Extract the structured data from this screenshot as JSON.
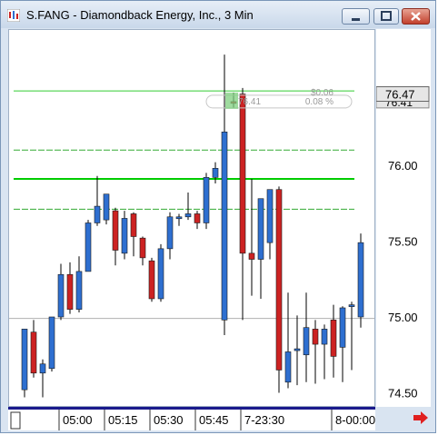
{
  "window": {
    "title": "S.FANG - Diamondback Energy, Inc., 3 Min"
  },
  "chart_data": {
    "type": "candlestick",
    "symbol": "S.FANG",
    "timeframe": "3 Min",
    "ylim": [
      74.4,
      76.85
    ],
    "y_ticks": [
      "76.00",
      "75.50",
      "75.00",
      "74.50"
    ],
    "y_tick_values": [
      76.0,
      75.5,
      75.0,
      74.5
    ],
    "x_ticks": [
      "05:00",
      "05:15",
      "05:30",
      "05:45",
      "7-23:30",
      "8-00:00"
    ],
    "x_tick_index": [
      3,
      8,
      13,
      18,
      23,
      33
    ],
    "price_label": "76.47",
    "price_label_value": 76.47,
    "sub_label": "76.41",
    "sub_label_value": 76.42,
    "order_tag": {
      "price": "76.41",
      "change": "$0.06",
      "percent": "0.08 %"
    },
    "horizontal_lines": [
      {
        "price": 76.49,
        "style": "solid",
        "color": "#33cc33"
      },
      {
        "price": 76.1,
        "style": "dashed",
        "color": "#33aa33"
      },
      {
        "price": 75.91,
        "style": "solid",
        "color": "#00cc00"
      },
      {
        "price": 75.71,
        "style": "dashed",
        "color": "#33aa33"
      },
      {
        "price": 74.99,
        "style": "solid",
        "color": "#b0b0b0"
      }
    ],
    "colors": {
      "up": "#2e6fd0",
      "down": "#cc2222",
      "wick": "#000000"
    },
    "candles": [
      {
        "o": 74.52,
        "h": 74.92,
        "l": 74.47,
        "c": 74.92
      },
      {
        "o": 74.9,
        "h": 74.98,
        "l": 74.6,
        "c": 74.63
      },
      {
        "o": 74.63,
        "h": 74.72,
        "l": 74.47,
        "c": 74.69
      },
      {
        "o": 74.66,
        "h": 75.0,
        "l": 74.64,
        "c": 75.0
      },
      {
        "o": 75.0,
        "h": 75.35,
        "l": 74.98,
        "c": 75.28
      },
      {
        "o": 75.28,
        "h": 75.36,
        "l": 75.02,
        "c": 75.05
      },
      {
        "o": 75.05,
        "h": 75.4,
        "l": 75.03,
        "c": 75.3
      },
      {
        "o": 75.3,
        "h": 75.64,
        "l": 75.3,
        "c": 75.62
      },
      {
        "o": 75.62,
        "h": 75.93,
        "l": 75.6,
        "c": 75.73
      },
      {
        "o": 75.64,
        "h": 75.81,
        "l": 75.61,
        "c": 75.81
      },
      {
        "o": 75.7,
        "h": 75.72,
        "l": 75.34,
        "c": 75.44
      },
      {
        "o": 75.42,
        "h": 75.7,
        "l": 75.38,
        "c": 75.65
      },
      {
        "o": 75.68,
        "h": 75.69,
        "l": 75.4,
        "c": 75.53
      },
      {
        "o": 75.52,
        "h": 75.53,
        "l": 75.34,
        "c": 75.39
      },
      {
        "o": 75.37,
        "h": 75.39,
        "l": 75.1,
        "c": 75.12
      },
      {
        "o": 75.12,
        "h": 75.48,
        "l": 75.1,
        "c": 75.45
      },
      {
        "o": 75.45,
        "h": 75.69,
        "l": 75.38,
        "c": 75.66
      },
      {
        "o": 75.65,
        "h": 75.68,
        "l": 75.6,
        "c": 75.66
      },
      {
        "o": 75.66,
        "h": 75.82,
        "l": 75.64,
        "c": 75.68
      },
      {
        "o": 75.68,
        "h": 75.7,
        "l": 75.58,
        "c": 75.62
      },
      {
        "o": 75.62,
        "h": 75.95,
        "l": 75.58,
        "c": 75.92
      },
      {
        "o": 75.92,
        "h": 76.02,
        "l": 75.88,
        "c": 75.98
      },
      {
        "o": 74.98,
        "h": 76.73,
        "l": 74.88,
        "c": 76.22
      },
      {
        "o": 76.42,
        "h": 76.48,
        "l": 76.38,
        "c": 76.41
      },
      {
        "o": 76.47,
        "h": 76.51,
        "l": 74.98,
        "c": 75.42
      },
      {
        "o": 75.42,
        "h": 75.91,
        "l": 75.14,
        "c": 75.38
      },
      {
        "o": 75.38,
        "h": 75.72,
        "l": 75.12,
        "c": 75.78
      },
      {
        "o": 75.49,
        "h": 75.84,
        "l": 75.38,
        "c": 75.84
      },
      {
        "o": 75.84,
        "h": 75.86,
        "l": 74.5,
        "c": 74.65
      },
      {
        "o": 74.57,
        "h": 75.16,
        "l": 74.53,
        "c": 74.77
      },
      {
        "o": 74.78,
        "h": 75.01,
        "l": 74.55,
        "c": 74.79
      },
      {
        "o": 74.75,
        "h": 75.16,
        "l": 74.57,
        "c": 74.93
      },
      {
        "o": 74.92,
        "h": 74.98,
        "l": 74.56,
        "c": 74.82
      },
      {
        "o": 74.82,
        "h": 74.95,
        "l": 74.59,
        "c": 74.92
      },
      {
        "o": 74.98,
        "h": 75.08,
        "l": 74.6,
        "c": 74.74
      },
      {
        "o": 74.8,
        "h": 75.07,
        "l": 74.57,
        "c": 75.06
      },
      {
        "o": 75.07,
        "h": 75.1,
        "l": 74.65,
        "c": 75.08
      },
      {
        "o": 75.0,
        "h": 75.55,
        "l": 74.93,
        "c": 75.49
      }
    ]
  }
}
